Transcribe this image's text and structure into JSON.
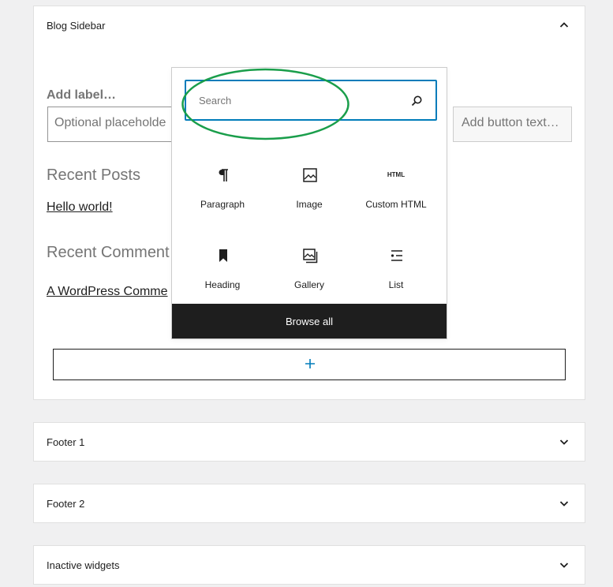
{
  "widget_areas": [
    {
      "title": "Blog Sidebar",
      "expanded": true
    },
    {
      "title": "Footer 1",
      "expanded": false
    },
    {
      "title": "Footer 2",
      "expanded": false
    },
    {
      "title": "Inactive widgets",
      "expanded": false
    }
  ],
  "search_widget": {
    "label_placeholder": "Add label…",
    "input_placeholder": "Optional placeholde",
    "button_placeholder": "Add button text…"
  },
  "recent_posts": {
    "heading": "Recent Posts",
    "items": [
      "Hello world!"
    ]
  },
  "recent_comments": {
    "heading": "Recent Comment",
    "items": [
      "A WordPress Comme"
    ]
  },
  "inserter": {
    "search_placeholder": "Search",
    "blocks": [
      {
        "label": "Paragraph",
        "icon": "paragraph-icon"
      },
      {
        "label": "Image",
        "icon": "image-icon"
      },
      {
        "label": "Custom HTML",
        "icon": "html-icon",
        "icon_text": "HTML"
      },
      {
        "label": "Heading",
        "icon": "bookmark-icon"
      },
      {
        "label": "Gallery",
        "icon": "gallery-icon"
      },
      {
        "label": "List",
        "icon": "list-icon"
      }
    ],
    "browse_all": "Browse all"
  },
  "colors": {
    "accent": "#007cba",
    "annotation": "#1a9e4b",
    "dark": "#1e1e1e"
  }
}
